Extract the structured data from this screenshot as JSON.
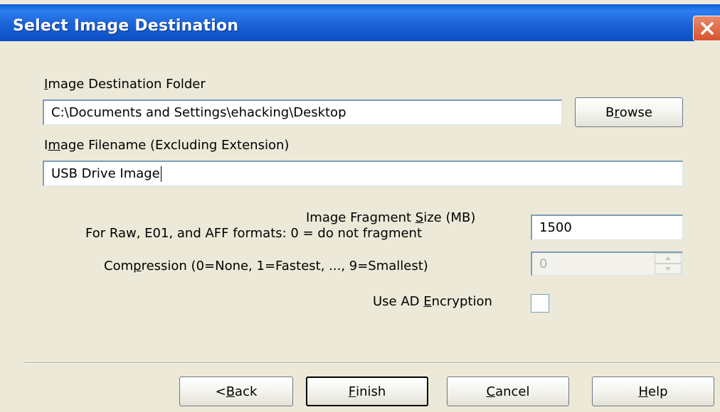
{
  "dialog": {
    "title": "Select Image Destination"
  },
  "destination_folder": {
    "label_first": "I",
    "label_rest": "mage Destination Folder",
    "value": "C:\\Documents and Settings\\ehacking\\Desktop",
    "browse_pre": "B",
    "browse_key": "r",
    "browse_post": "owse"
  },
  "filename": {
    "label_pre": "I",
    "label_key": "m",
    "label_post": "age Filename (Excluding Extension)",
    "value": "USB Drive Image"
  },
  "fragment": {
    "label_pre": "Image Fragment ",
    "label_key": "S",
    "label_post": "ize (MB)",
    "note": "For Raw, E01, and AFF formats: 0 = do not fragment",
    "value": "1500"
  },
  "compression": {
    "label_pre": "Com",
    "label_key": "p",
    "label_post": "ression (0=None, 1=Fastest, ..., 9=Smallest)",
    "value": "0"
  },
  "encryption": {
    "label_pre": "Use AD ",
    "label_key": "E",
    "label_post": "ncryption",
    "checked": false
  },
  "buttons": {
    "back_pre": "< ",
    "back_key": "B",
    "back_post": "ack",
    "finish_key": "F",
    "finish_post": "inish",
    "cancel_key": "C",
    "cancel_post": "ancel",
    "help_key": "H",
    "help_post": "elp"
  }
}
